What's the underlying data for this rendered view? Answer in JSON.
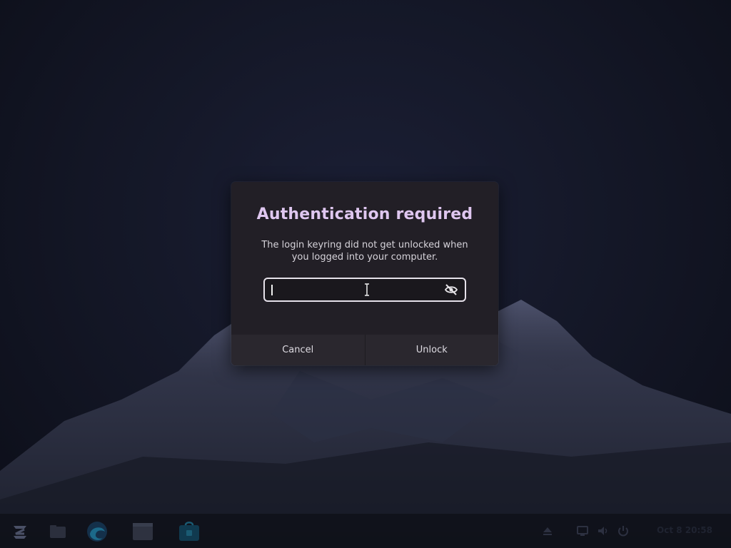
{
  "dialog": {
    "title": "Authentication required",
    "message": "The login keyring did not get unlocked when you logged into your computer.",
    "password": {
      "value": "",
      "reveal_icon": "eye-slash-icon"
    },
    "buttons": {
      "cancel_label": "Cancel",
      "unlock_label": "Unlock"
    },
    "accent_color": "#dfc7f0"
  },
  "taskbar": {
    "apps": [
      {
        "name": "Zorin menu",
        "icon": "zorin-logo-icon"
      },
      {
        "name": "Files",
        "icon": "folder-icon"
      },
      {
        "name": "Microsoft Edge",
        "icon": "edge-browser-icon"
      },
      {
        "name": "Files window",
        "icon": "file-manager-icon"
      },
      {
        "name": "Software",
        "icon": "software-store-icon"
      }
    ],
    "tray_icons": [
      "eject-icon",
      "display-icon",
      "volume-icon",
      "power-icon"
    ],
    "clock": "Oct 8  20:58"
  }
}
